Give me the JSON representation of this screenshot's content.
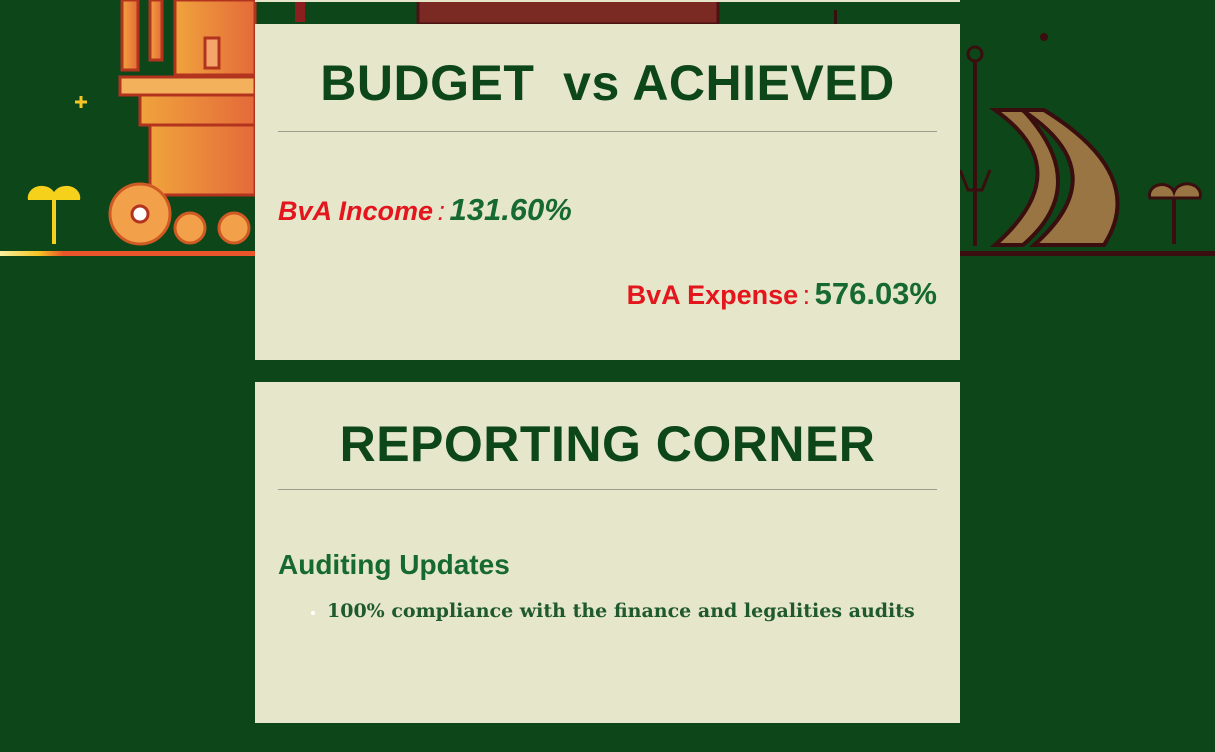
{
  "budget_card": {
    "title": "BUDGET  vs ACHIEVED",
    "income": {
      "label": "BvA Income",
      "separator": ":",
      "value": "131.60%"
    },
    "expense": {
      "label": "BvA Expense",
      "separator": ":",
      "value": "576.03%"
    }
  },
  "reporting_card": {
    "title": "REPORTING CORNER",
    "subheading": "Auditing Updates",
    "items": [
      "100% compliance with the finance and legalities audits"
    ]
  },
  "colors": {
    "background": "#0c4619",
    "card": "#e6e6ca",
    "heading": "#0c4619",
    "label_red": "#e3161d",
    "value_green": "#16692f"
  },
  "icons": [
    "temple-tower-illustration",
    "lamp-post-illustration",
    "sail-monument-illustration",
    "tree-icon"
  ]
}
